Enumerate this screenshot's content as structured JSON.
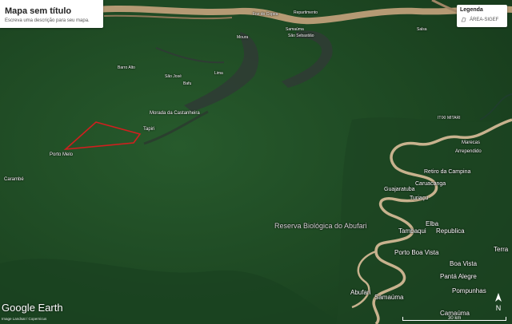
{
  "panel": {
    "title": "Mapa sem título",
    "description": "Escreva uma descrição para seu mapa."
  },
  "legend": {
    "title": "Legenda",
    "item_label": "ÁREA-SIGEF",
    "item_icon": "polygon-outline-icon"
  },
  "branding": {
    "logo": "Google Earth",
    "credit": "Image Landsat / Copernicus"
  },
  "scale": {
    "label": "30 km"
  },
  "compass": {
    "label": "N"
  },
  "colors": {
    "forest": "#1f4a25",
    "river": "#b59a74",
    "lake": "#2f3c34",
    "polygon": "#d11f1f"
  },
  "places": [
    {
      "name": "Moura"
    },
    {
      "name": "Barro Alto"
    },
    {
      "name": "São José"
    },
    {
      "name": "Bafu"
    },
    {
      "name": "Lima"
    },
    {
      "name": "Morada da Castanheira"
    },
    {
      "name": "Tapiri"
    },
    {
      "name": "Porto Melo"
    },
    {
      "name": "Carambé"
    },
    {
      "name": "Foz do Copea"
    },
    {
      "name": "Repartimento"
    },
    {
      "name": "Samaúma"
    },
    {
      "name": "São Sebastião"
    },
    {
      "name": "Salsa"
    },
    {
      "name": "ITIXI MITARI"
    },
    {
      "name": "Marecas"
    },
    {
      "name": "Arrependido"
    },
    {
      "name": "Retiro da Campina"
    },
    {
      "name": "Caruacanga"
    },
    {
      "name": "Guajaratuba"
    },
    {
      "name": "Turiaçu"
    },
    {
      "name": "Elba"
    },
    {
      "name": "Tambaqui"
    },
    {
      "name": "Republica"
    },
    {
      "name": "Porto Boa Vista"
    },
    {
      "name": "Boa Vista"
    },
    {
      "name": "Pantá Alegre"
    },
    {
      "name": "Pompunhas"
    },
    {
      "name": "Camaúma"
    },
    {
      "name": "Abufari"
    },
    {
      "name": "Samaúma"
    },
    {
      "name": "Terra"
    },
    {
      "name": "Reserva Biológica do Abufari"
    }
  ]
}
